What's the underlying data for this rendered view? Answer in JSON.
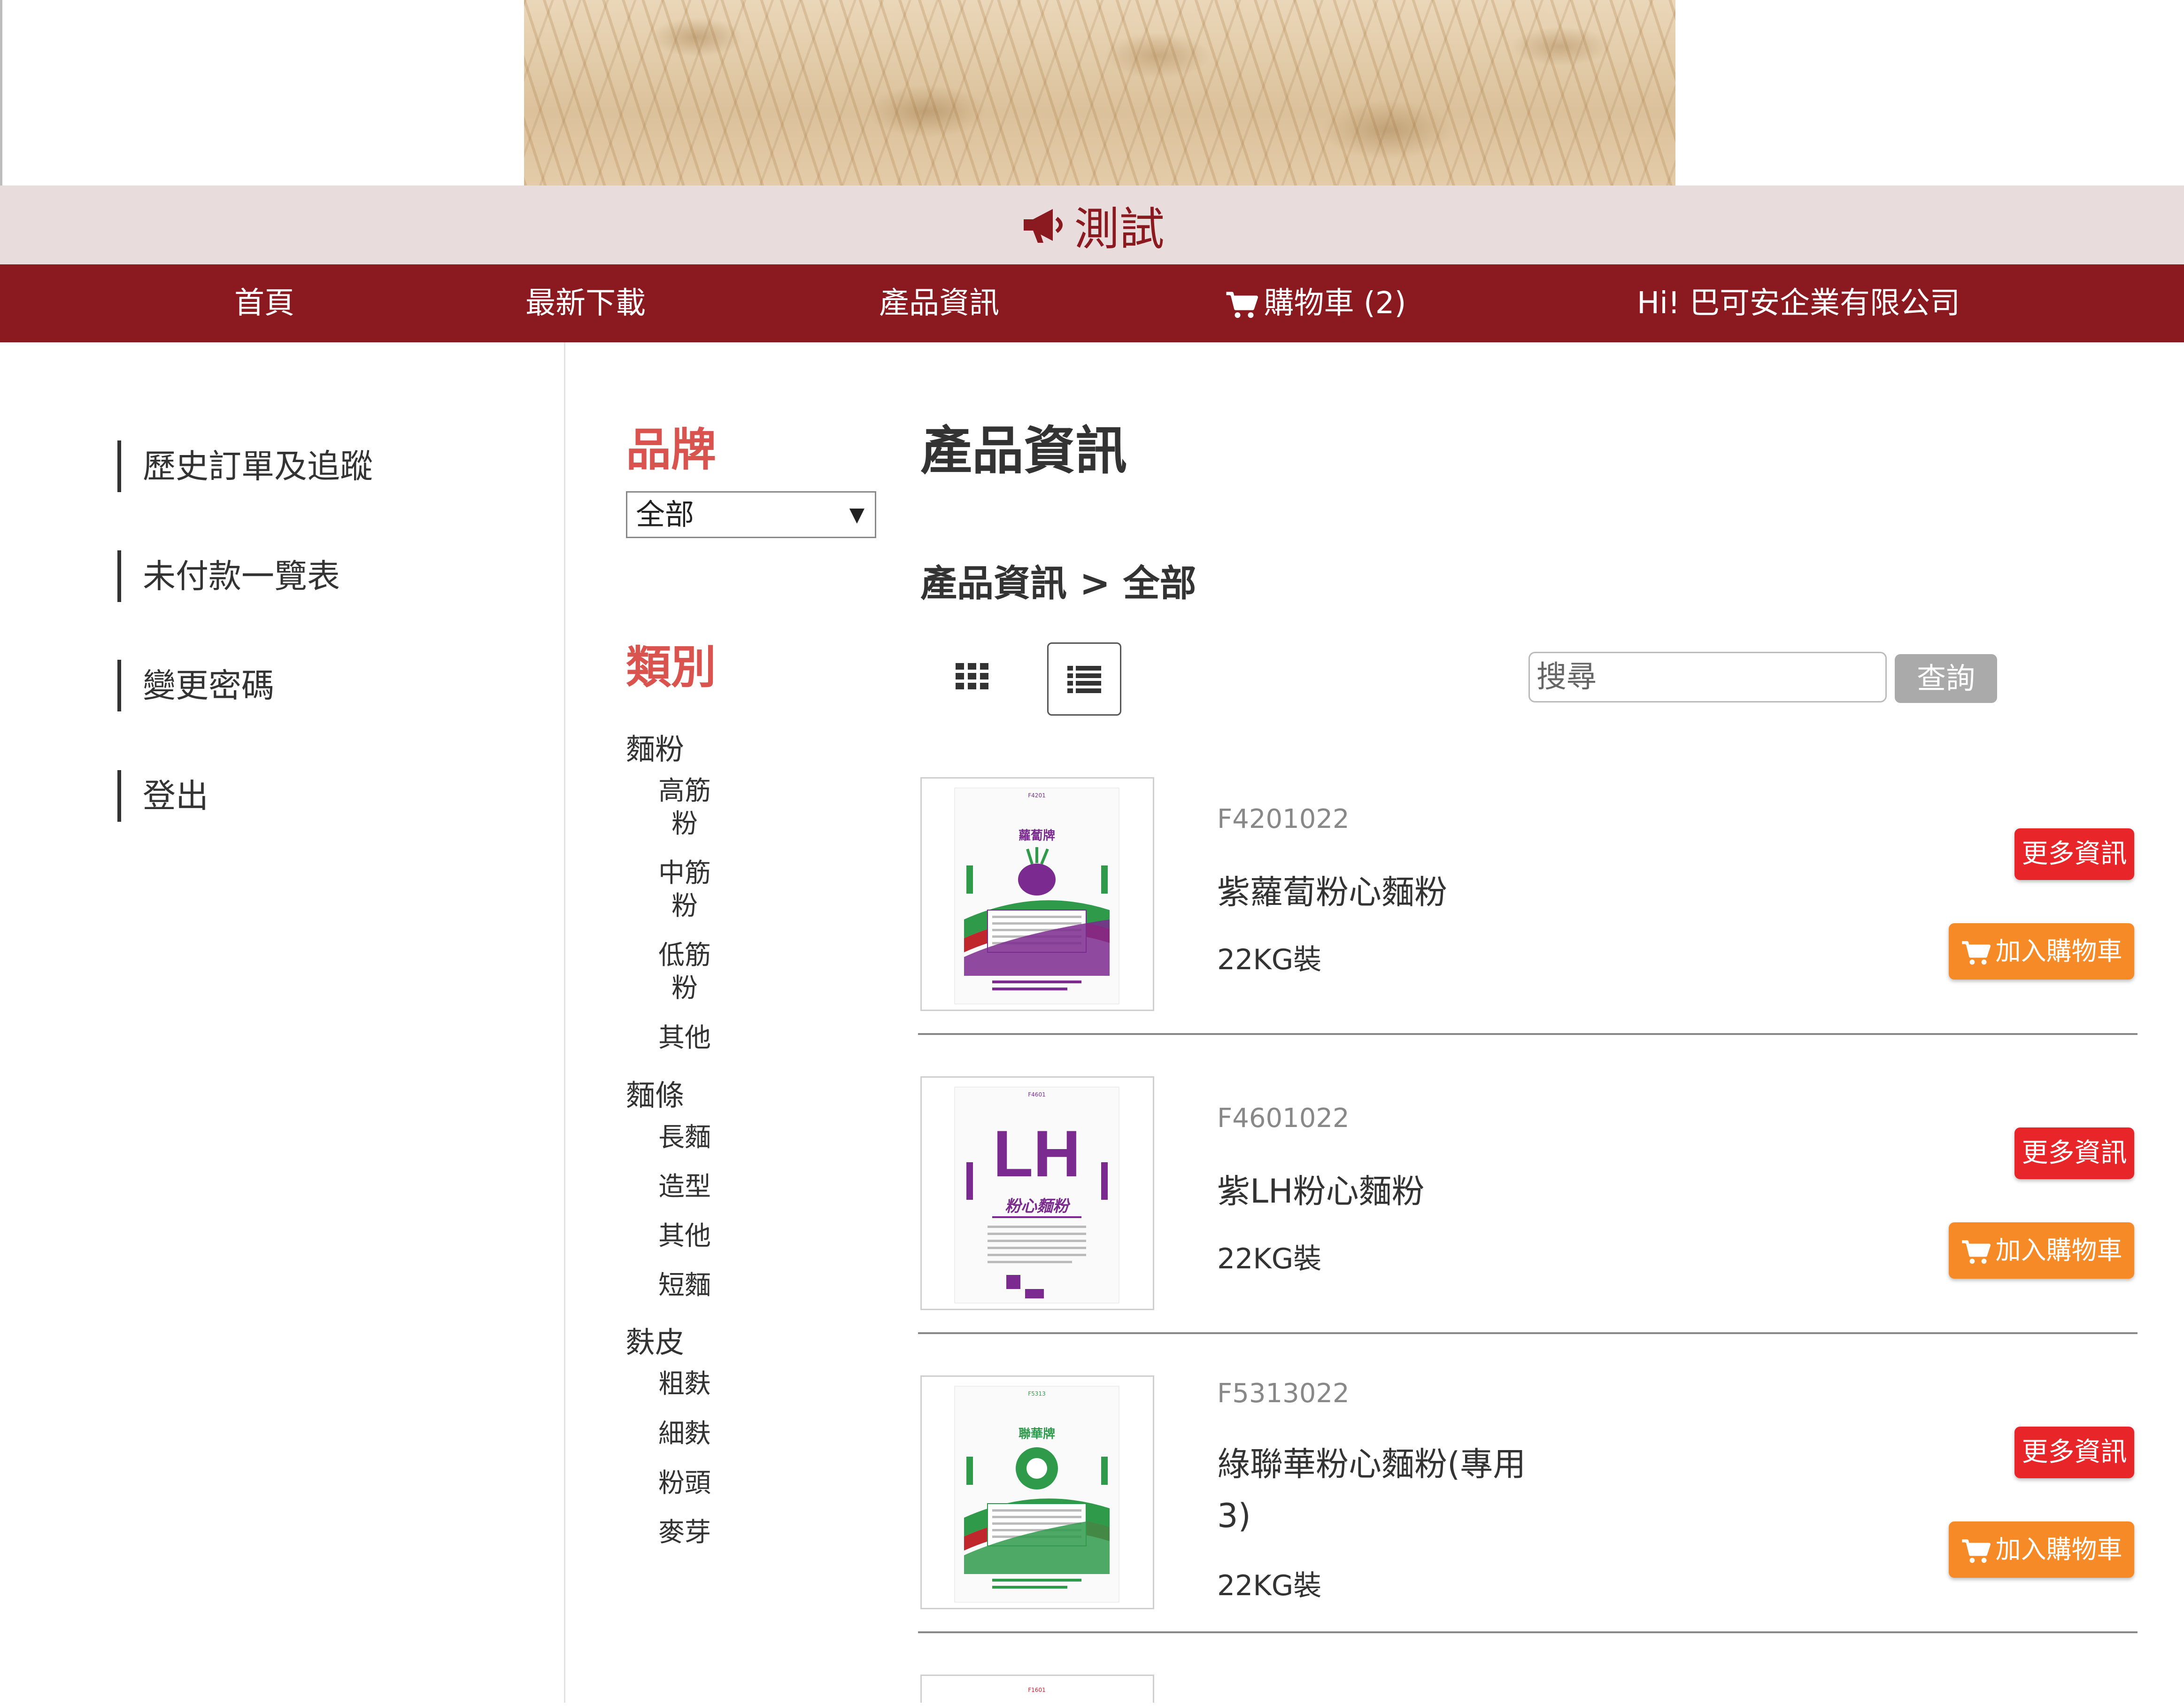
{
  "announcement": {
    "text": "測試"
  },
  "nav": {
    "home": "首頁",
    "downloads": "最新下載",
    "products": "產品資訊",
    "cart": "購物車 (2)",
    "greeting": "Hi! 巴可安企業有限公司"
  },
  "sidebar": {
    "items": [
      {
        "label": "歷史訂單及追蹤"
      },
      {
        "label": "未付款一覽表"
      },
      {
        "label": "變更密碼"
      },
      {
        "label": "登出"
      }
    ]
  },
  "filters": {
    "brand_title": "品牌",
    "brand_selected": "全部",
    "category_title": "類別",
    "groups": [
      {
        "label": "麵粉",
        "subs": [
          "高筋粉",
          "中筋粉",
          "低筋粉",
          "其他"
        ]
      },
      {
        "label": "麵條",
        "subs": [
          "長麵",
          "造型",
          "其他",
          "短麵"
        ]
      },
      {
        "label": "麩皮",
        "subs": [
          "粗麩",
          "細麩",
          "粉頭",
          "麥芽"
        ]
      }
    ]
  },
  "main": {
    "title": "產品資訊",
    "breadcrumb": "產品資訊 > 全部",
    "search_placeholder": "搜尋",
    "search_button": "查詢"
  },
  "products": [
    {
      "code": "F4201022",
      "name": "紫蘿蔔粉心麵粉",
      "spec": "22KG裝",
      "more": "更多資訊",
      "add": "加入購物車",
      "bag_label": "蘿蔔牌",
      "bag_code": "F4201"
    },
    {
      "code": "F4601022",
      "name": "紫LH粉心麵粉",
      "spec": "22KG裝",
      "more": "更多資訊",
      "add": "加入購物車",
      "bag_label": "粉心麵粉",
      "bag_code": "F4601"
    },
    {
      "code": "F5313022",
      "name": "綠聯華粉心麵粉(專用3)",
      "spec": "22KG裝",
      "more": "更多資訊",
      "add": "加入購物車",
      "bag_label": "聯華牌",
      "bag_code": "F5313"
    }
  ],
  "next_bag_code": "F1601",
  "colors": {
    "brand_dark_red": "#8b1a20",
    "announce_bg": "#e8dcdc",
    "filter_title": "#d9534f",
    "more_button": "#e8262a",
    "cart_button": "#f58a27",
    "search_button": "#aaaaaa",
    "bag_purple": "#7b2a8f",
    "bag_green": "#2e9a4a",
    "bag_red": "#c0272d"
  },
  "icons": {
    "announce": "megaphone-icon",
    "cart": "shopping-cart-icon",
    "grid": "grid-view-icon",
    "list": "list-view-icon",
    "dropdown": "dropdown-arrow-icon"
  }
}
